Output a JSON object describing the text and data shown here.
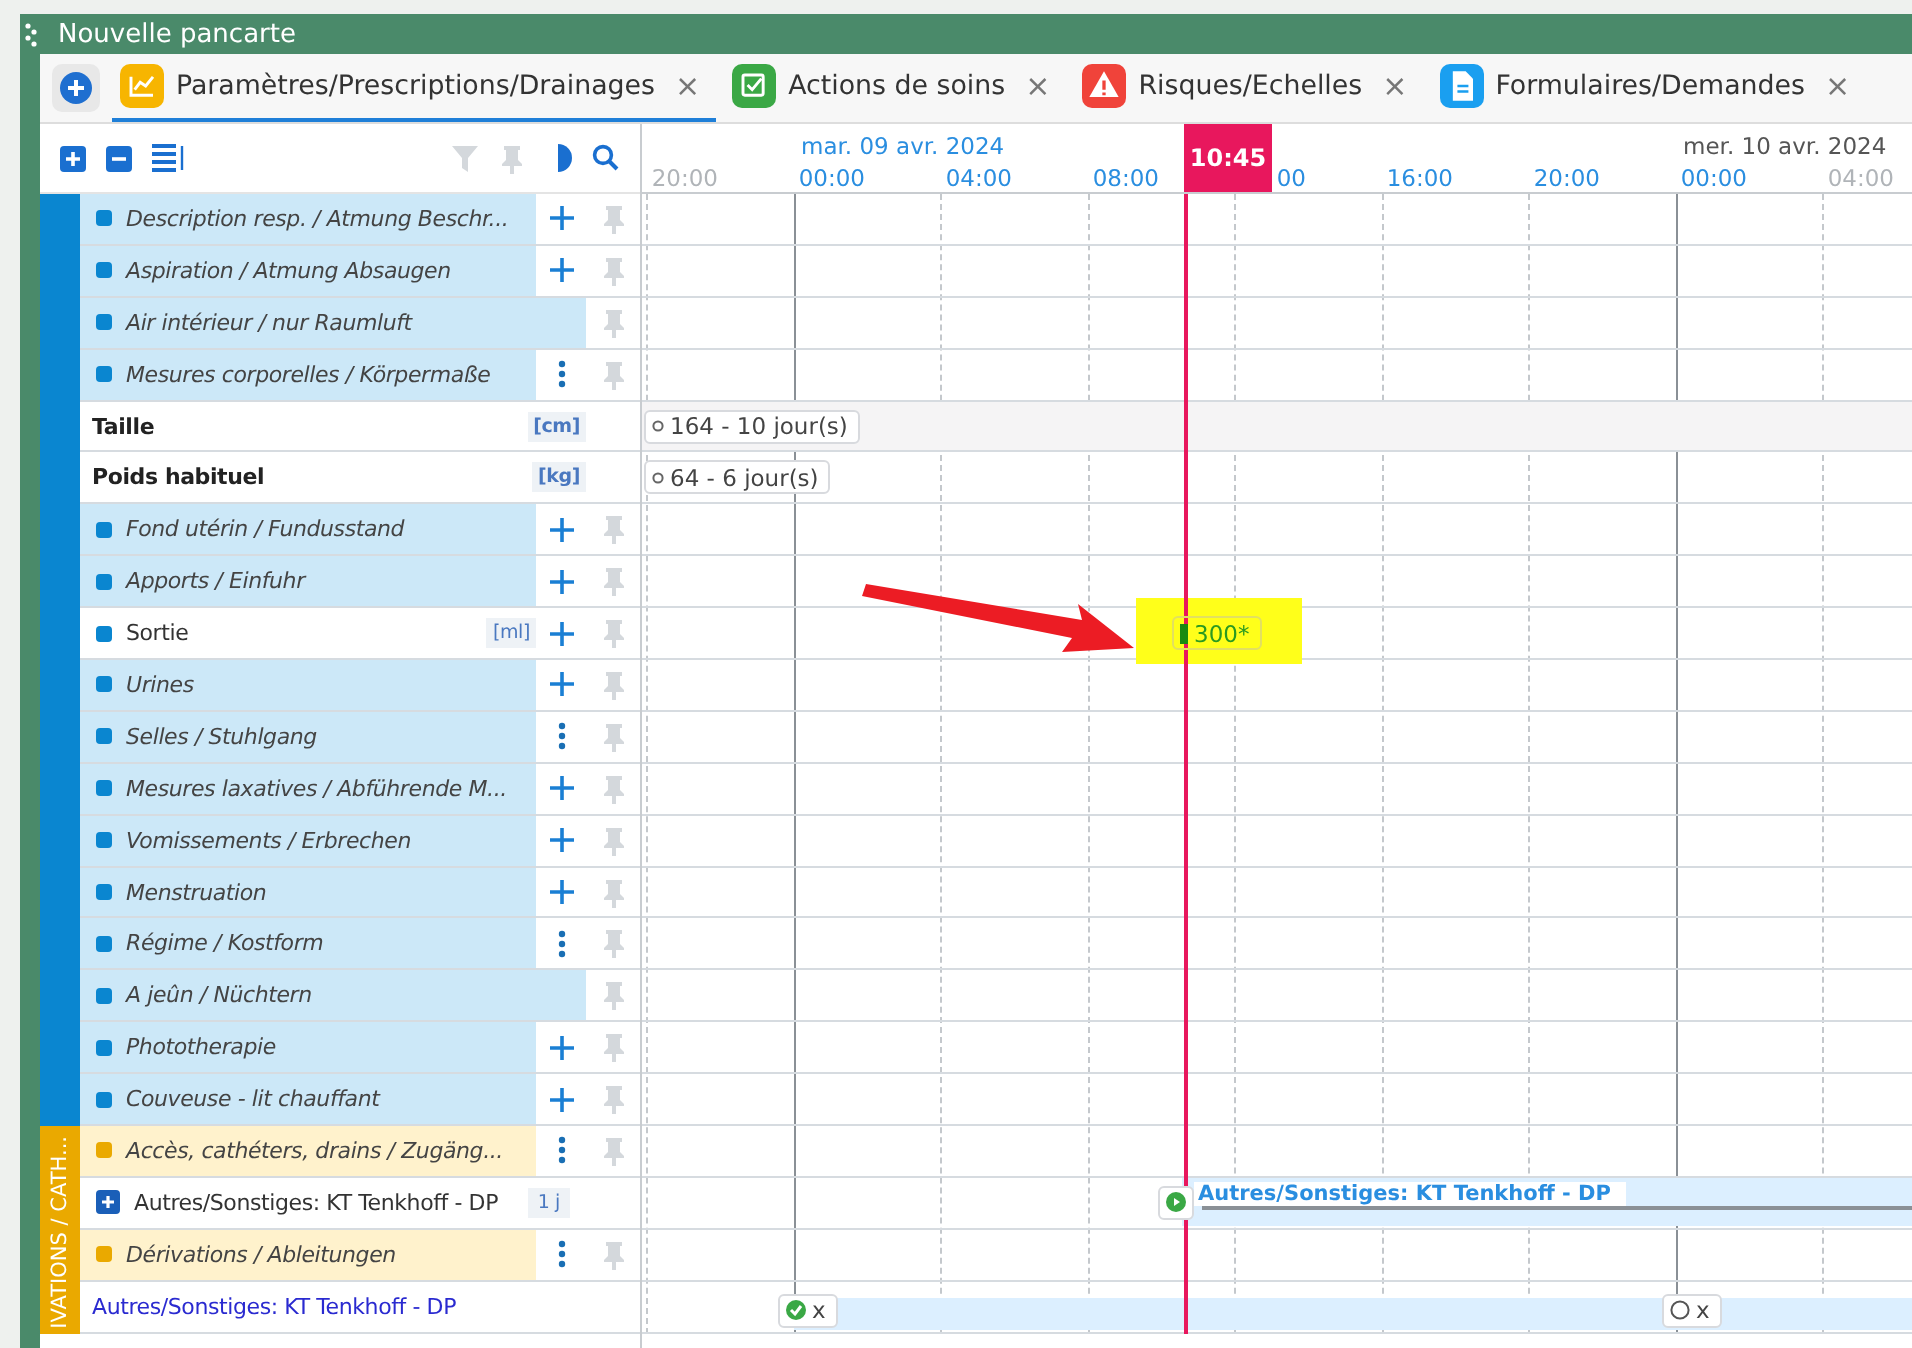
{
  "window": {
    "title": "Nouvelle pancarte"
  },
  "tabs": [
    {
      "label": "Paramètres/Prescriptions/Drainages",
      "close": "×",
      "color": "#f7b500",
      "selected": true
    },
    {
      "label": "Actions de soins",
      "close": "×",
      "color": "#3aa845",
      "selected": false
    },
    {
      "label": "Risques/Echelles",
      "close": "×",
      "color": "#f0433a",
      "selected": false
    },
    {
      "label": "Formulaires/Demandes",
      "close": "×",
      "color": "#1a9ff0",
      "selected": false
    }
  ],
  "timeline": {
    "ticks": [
      {
        "label": "20:00",
        "dim": true
      },
      {
        "label": "00:00",
        "dim": false,
        "day": "mar. 09 avr. 2024"
      },
      {
        "label": "04:00",
        "dim": false
      },
      {
        "label": "08:00",
        "dim": false
      },
      {
        "label": "00",
        "dim": false
      },
      {
        "label": "16:00",
        "dim": false
      },
      {
        "label": "20:00",
        "dim": false
      },
      {
        "label": "00:00",
        "dim": false,
        "day": "mer. 10 avr. 2024"
      },
      {
        "label": "04:00",
        "dim": true
      }
    ],
    "now": "10:45"
  },
  "sections": [
    {
      "color": "#0a86d0",
      "rows": [
        {
          "kind": "group",
          "label": "Description resp. / Atmung Beschr...",
          "add_button": true,
          "menu_button": false,
          "pin": true
        },
        {
          "kind": "group",
          "label": "Aspiration / Atmung Absaugen",
          "add_button": true,
          "menu_button": false,
          "pin": true
        },
        {
          "kind": "group",
          "label": "Air intérieur / nur Raumluft",
          "add_button": false,
          "menu_button": false,
          "pin": true
        },
        {
          "kind": "group",
          "label": "Mesures corporelles / Körpermaße",
          "add_button": false,
          "menu_button": true,
          "pin": true
        },
        {
          "kind": "param",
          "label": "Taille",
          "unit": "[cm]",
          "add_button": false,
          "menu_button": false,
          "pin": false,
          "events": [
            {
              "kind": "value",
              "text": "164 - 10 jour(s)"
            }
          ]
        },
        {
          "kind": "param",
          "label": "Poids habituel",
          "unit": "[kg]",
          "add_button": false,
          "menu_button": false,
          "pin": false,
          "events": [
            {
              "kind": "value",
              "text": "64 - 6 jour(s)"
            }
          ]
        },
        {
          "kind": "group",
          "label": "Fond utérin / Fundusstand",
          "add_button": true,
          "menu_button": false,
          "pin": true
        },
        {
          "kind": "group",
          "label": "Apports / Einfuhr",
          "add_button": true,
          "menu_button": false,
          "pin": true
        },
        {
          "kind": "measure",
          "label": "Sortie",
          "unit": "[ml]",
          "add_button": true,
          "menu_button": false,
          "pin": true,
          "events": [
            {
              "kind": "highlight",
              "text": "300*"
            }
          ]
        },
        {
          "kind": "group",
          "label": "Urines",
          "add_button": true,
          "menu_button": false,
          "pin": true
        },
        {
          "kind": "group",
          "label": "Selles / Stuhlgang",
          "add_button": false,
          "menu_button": true,
          "pin": true
        },
        {
          "kind": "group",
          "label": "Mesures laxatives / Abführende M...",
          "add_button": true,
          "menu_button": false,
          "pin": true
        },
        {
          "kind": "group",
          "label": "Vomissements / Erbrechen",
          "add_button": true,
          "menu_button": false,
          "pin": true
        },
        {
          "kind": "group",
          "label": "Menstruation",
          "add_button": true,
          "menu_button": false,
          "pin": true
        },
        {
          "kind": "group",
          "label": "Régime / Kostform",
          "add_button": false,
          "menu_button": true,
          "pin": true
        },
        {
          "kind": "group",
          "label": "A jeûn / Nüchtern",
          "add_button": false,
          "menu_button": false,
          "pin": true
        },
        {
          "kind": "group",
          "label": "Phototherapie",
          "add_button": true,
          "menu_button": false,
          "pin": true
        },
        {
          "kind": "group",
          "label": "Couveuse - lit chauffant",
          "add_button": true,
          "menu_button": false,
          "pin": true
        }
      ]
    },
    {
      "title": "IVATIONS / CATH...",
      "color": "#eaa900",
      "rows": [
        {
          "kind": "group",
          "label": "Accès, cathéters, drains / Zugäng...",
          "add_button": false,
          "menu_button": true,
          "pin": true
        },
        {
          "kind": "item",
          "label": "Autres/Sonstiges: KT Tenkhoff - DP",
          "badge": "1 j",
          "add_button": false,
          "menu_button": false,
          "pin": false,
          "events": [
            {
              "kind": "bar",
              "text": "Autres/Sonstiges: KT Tenkhoff - DP"
            }
          ]
        },
        {
          "kind": "group",
          "label": "Dérivations / Ableitungen",
          "add_button": false,
          "menu_button": true,
          "pin": true
        },
        {
          "kind": "link",
          "label": "Autres/Sonstiges: KT Tenkhoff - DP",
          "add_button": false,
          "menu_button": false,
          "pin": false,
          "events": [
            {
              "kind": "done",
              "text": "x"
            },
            {
              "kind": "pending",
              "text": "x"
            }
          ]
        }
      ]
    }
  ]
}
